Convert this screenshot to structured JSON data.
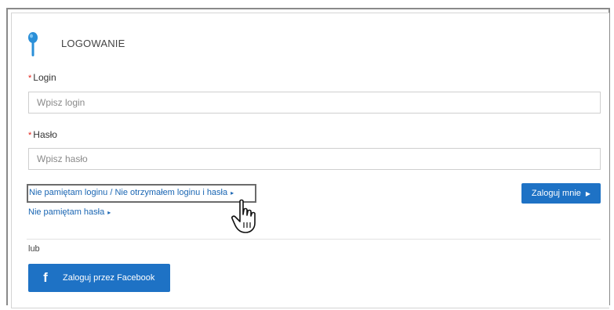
{
  "form": {
    "title": "LOGOWANIE",
    "login_label": "Login",
    "login_placeholder": "Wpisz login",
    "password_label": "Hasło",
    "password_placeholder": "Wpisz hasło",
    "required_mark": "*"
  },
  "links": {
    "forgot_login": "Nie pamiętam loginu / Nie otrzymałem loginu i hasła",
    "forgot_password": "Nie pamiętam hasła",
    "arrow": "▸"
  },
  "buttons": {
    "login": "Zaloguj mnie",
    "login_arrow": "▶",
    "or_text": "lub",
    "facebook": "Zaloguj przez Facebook",
    "facebook_icon": "f"
  },
  "colors": {
    "accent": "#1e72c5",
    "link": "#1a66b3",
    "required": "#e2231a"
  }
}
